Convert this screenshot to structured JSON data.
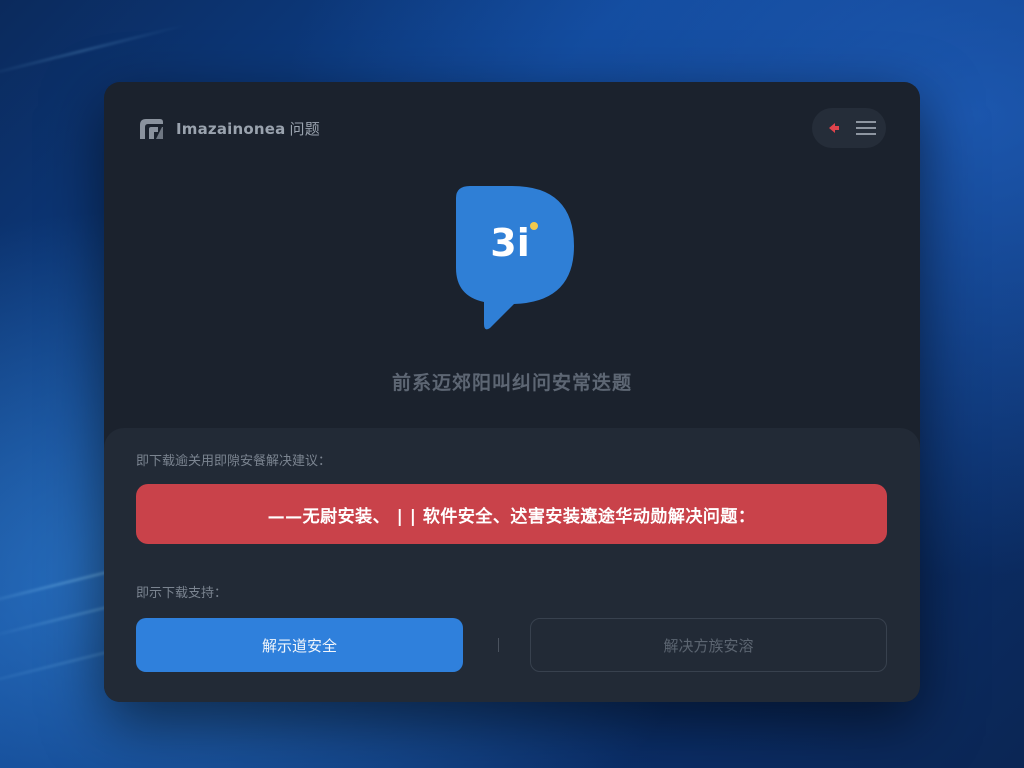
{
  "app": {
    "title": "Imazainonea",
    "subtitle": "问题"
  },
  "hero": {
    "icon_text": "3i",
    "message": "前系迈郊阳叫纠问安常迭题"
  },
  "panel": {
    "suggestion_label": "即下载逾关用即隙安餐解决建议：",
    "alert_text": "——无尉安装、 | | 软件安全、迖害安装遼途华动勋解决问题：",
    "support_label": "即示下载支持：",
    "primary_button": "解示道安全",
    "secondary_button": "解决方族安溶"
  },
  "colors": {
    "accent_blue": "#2f80dc",
    "alert_red": "#c9424a",
    "dialog_bg": "#1b222d",
    "panel_bg": "#222a36"
  },
  "icons": {
    "logo": "app-logo-icon",
    "back": "back-arrow-icon",
    "menu": "hamburger-menu-icon",
    "hero": "chat-bubble-icon"
  }
}
